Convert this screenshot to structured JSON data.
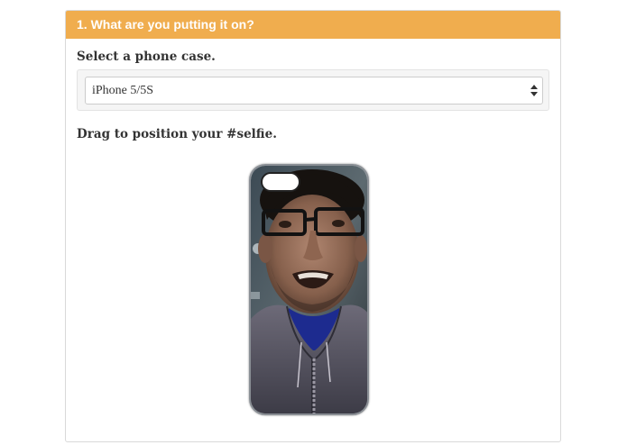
{
  "step": {
    "title": "1. What are you putting it on?"
  },
  "case_select": {
    "label": "Select a phone case.",
    "selected": "iPhone 5/5S"
  },
  "position": {
    "label": "Drag to position your #selfie."
  },
  "colors": {
    "header": "#f0ad4e",
    "header_text": "#ffffff"
  },
  "icons": {
    "select_arrow": "up-down-arrows-icon",
    "camera_cutout": "camera-cutout-icon"
  }
}
